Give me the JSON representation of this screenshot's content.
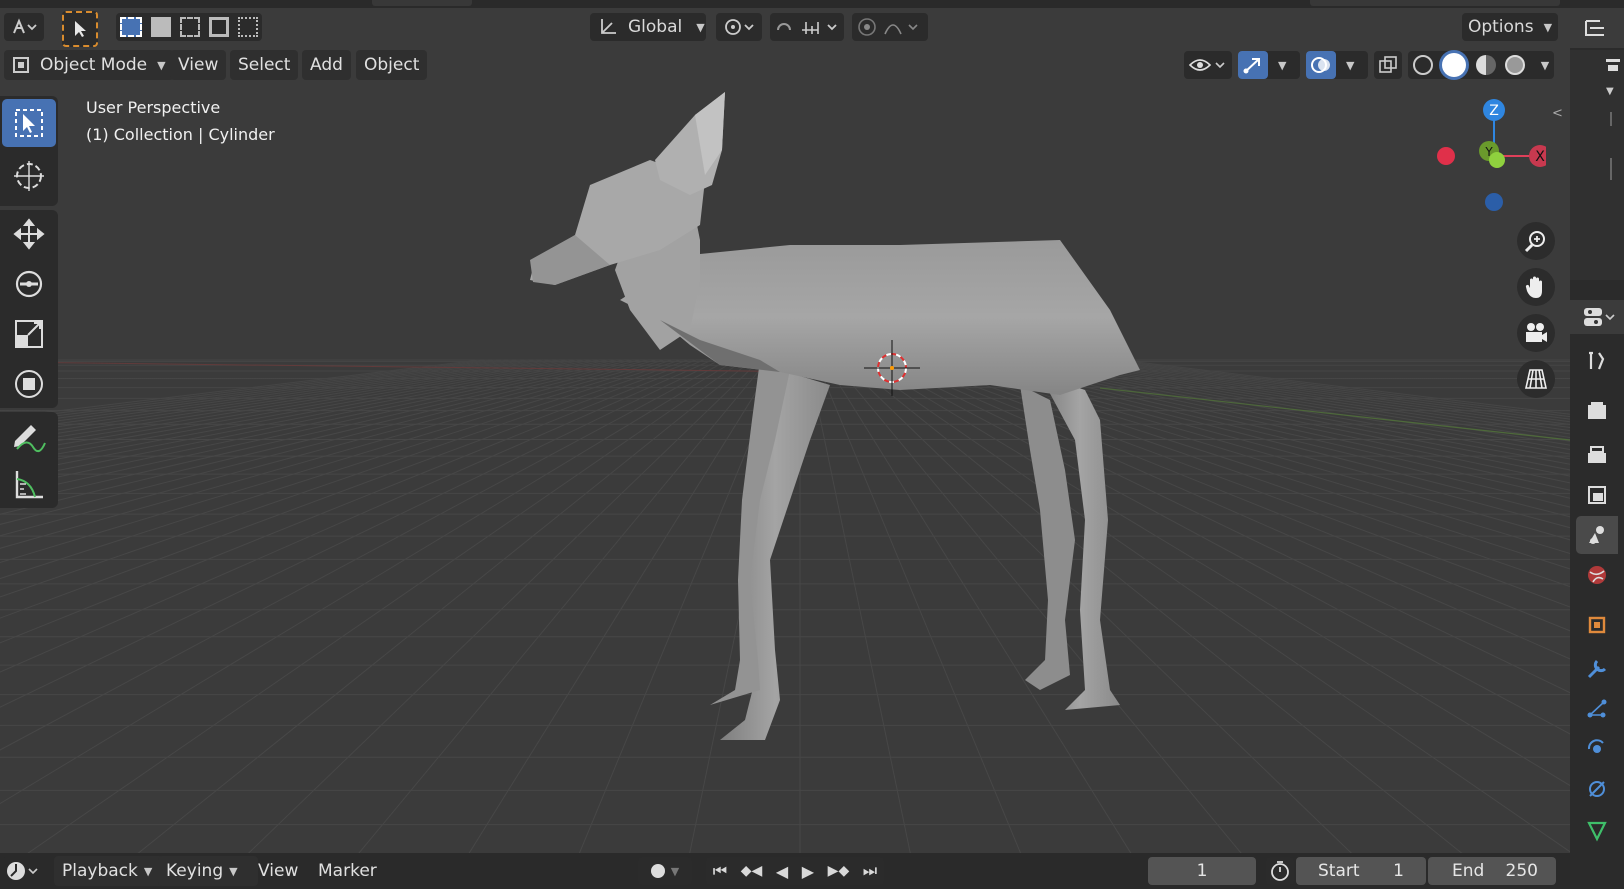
{
  "header": {
    "transform_orientation": "Global",
    "options_label": "Options"
  },
  "viewport_header": {
    "mode_label": "Object Mode",
    "menus": [
      "View",
      "Select",
      "Add",
      "Object"
    ]
  },
  "viewport_overlay": {
    "perspective": "User Perspective",
    "collection": "(1) Collection | Cylinder"
  },
  "gizmo": {
    "z_label": "Z",
    "y_label": "Y",
    "x_label": "X",
    "colors": {
      "x": "#e0405a",
      "y": "#7fb536",
      "z": "#2f86e0"
    }
  },
  "timeline": {
    "menus": [
      "Playback",
      "Keying",
      "View",
      "Marker"
    ],
    "current_frame": "1",
    "start_label": "Start",
    "start_value": "1",
    "end_label": "End",
    "end_value": "250"
  },
  "tools": [
    "select-box",
    "cursor",
    "move",
    "rotate",
    "scale",
    "transform",
    "annotate",
    "measure"
  ],
  "property_tabs": [
    "tool",
    "render",
    "output",
    "view-layer",
    "scene",
    "world",
    "object",
    "modifiers",
    "particles",
    "physics",
    "constraints",
    "data"
  ],
  "accent": "#4772b3"
}
